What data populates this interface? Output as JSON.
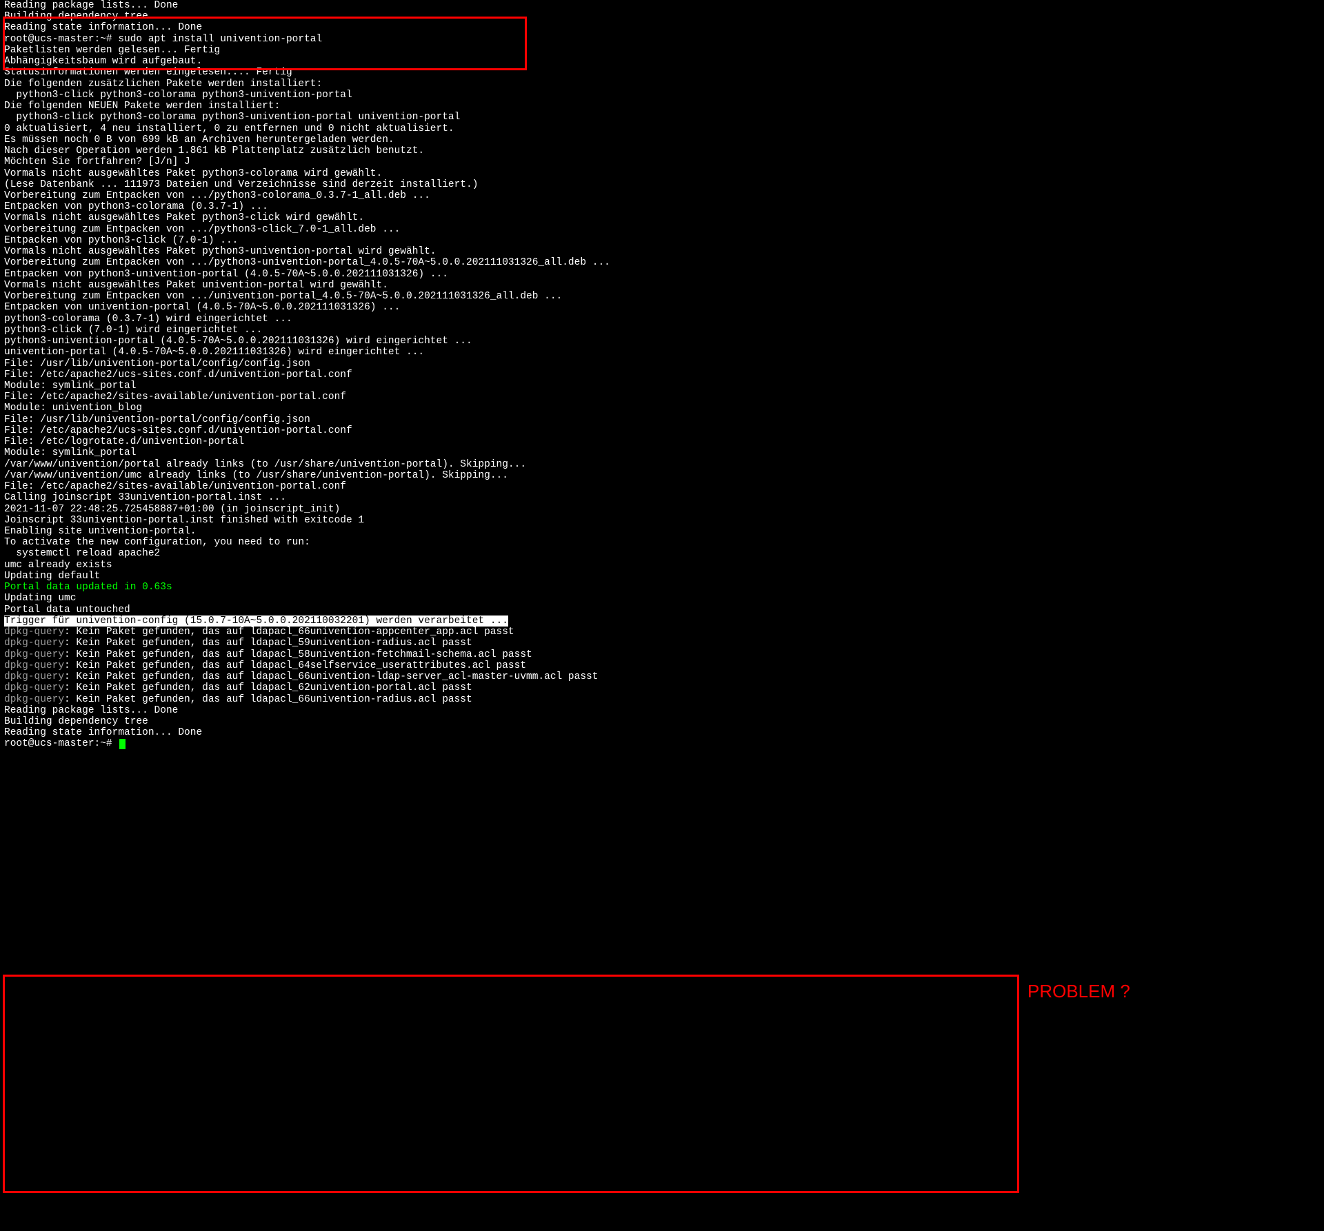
{
  "annotation": {
    "label": "PROBLEM ?"
  },
  "lines": [
    {
      "t": "Reading package lists... Done",
      "c": "white"
    },
    {
      "t": "Building dependency tree",
      "c": "white"
    },
    {
      "t": "Reading state information... Done",
      "c": "white"
    },
    {
      "t": "root@ucs-master:~# sudo apt install univention-portal",
      "c": "white",
      "kind": "prompt"
    },
    {
      "t": "Paketlisten werden gelesen... Fertig",
      "c": "white"
    },
    {
      "t": "Abhängigkeitsbaum wird aufgebaut.",
      "c": "white"
    },
    {
      "t": "Statusinformationen werden eingelesen.... Fertig",
      "c": "white"
    },
    {
      "t": "Die folgenden zusätzlichen Pakete werden installiert:",
      "c": "white"
    },
    {
      "t": "  python3-click python3-colorama python3-univention-portal",
      "c": "white"
    },
    {
      "t": "Die folgenden NEUEN Pakete werden installiert:",
      "c": "white"
    },
    {
      "t": "  python3-click python3-colorama python3-univention-portal univention-portal",
      "c": "white"
    },
    {
      "t": "0 aktualisiert, 4 neu installiert, 0 zu entfernen und 0 nicht aktualisiert.",
      "c": "white"
    },
    {
      "t": "Es müssen noch 0 B von 699 kB an Archiven heruntergeladen werden.",
      "c": "white"
    },
    {
      "t": "Nach dieser Operation werden 1.861 kB Plattenplatz zusätzlich benutzt.",
      "c": "white"
    },
    {
      "t": "Möchten Sie fortfahren? [J/n] J",
      "c": "white"
    },
    {
      "t": "Vormals nicht ausgewähltes Paket python3-colorama wird gewählt.",
      "c": "white"
    },
    {
      "t": "(Lese Datenbank ... 111973 Dateien und Verzeichnisse sind derzeit installiert.)",
      "c": "white"
    },
    {
      "t": "Vorbereitung zum Entpacken von .../python3-colorama_0.3.7-1_all.deb ...",
      "c": "white"
    },
    {
      "t": "Entpacken von python3-colorama (0.3.7-1) ...",
      "c": "white"
    },
    {
      "t": "Vormals nicht ausgewähltes Paket python3-click wird gewählt.",
      "c": "white"
    },
    {
      "t": "Vorbereitung zum Entpacken von .../python3-click_7.0-1_all.deb ...",
      "c": "white"
    },
    {
      "t": "Entpacken von python3-click (7.0-1) ...",
      "c": "white"
    },
    {
      "t": "Vormals nicht ausgewähltes Paket python3-univention-portal wird gewählt.",
      "c": "white"
    },
    {
      "t": "Vorbereitung zum Entpacken von .../python3-univention-portal_4.0.5-70A~5.0.0.202111031326_all.deb ...",
      "c": "white"
    },
    {
      "t": "Entpacken von python3-univention-portal (4.0.5-70A~5.0.0.202111031326) ...",
      "c": "white"
    },
    {
      "t": "Vormals nicht ausgewähltes Paket univention-portal wird gewählt.",
      "c": "white"
    },
    {
      "t": "Vorbereitung zum Entpacken von .../univention-portal_4.0.5-70A~5.0.0.202111031326_all.deb ...",
      "c": "white"
    },
    {
      "t": "Entpacken von univention-portal (4.0.5-70A~5.0.0.202111031326) ...",
      "c": "white"
    },
    {
      "t": "python3-colorama (0.3.7-1) wird eingerichtet ...",
      "c": "white"
    },
    {
      "t": "python3-click (7.0-1) wird eingerichtet ...",
      "c": "white"
    },
    {
      "t": "python3-univention-portal (4.0.5-70A~5.0.0.202111031326) wird eingerichtet ...",
      "c": "white"
    },
    {
      "t": "univention-portal (4.0.5-70A~5.0.0.202111031326) wird eingerichtet ...",
      "c": "white"
    },
    {
      "t": "File: /usr/lib/univention-portal/config/config.json",
      "c": "white"
    },
    {
      "t": "File: /etc/apache2/ucs-sites.conf.d/univention-portal.conf",
      "c": "white"
    },
    {
      "t": "Module: symlink_portal",
      "c": "white"
    },
    {
      "t": "File: /etc/apache2/sites-available/univention-portal.conf",
      "c": "white"
    },
    {
      "t": "Module: univention_blog",
      "c": "white"
    },
    {
      "t": "File: /usr/lib/univention-portal/config/config.json",
      "c": "white"
    },
    {
      "t": "File: /etc/apache2/ucs-sites.conf.d/univention-portal.conf",
      "c": "white"
    },
    {
      "t": "File: /etc/logrotate.d/univention-portal",
      "c": "white"
    },
    {
      "t": "Module: symlink_portal",
      "c": "white"
    },
    {
      "t": "/var/www/univention/portal already links (to /usr/share/univention-portal). Skipping...",
      "c": "white"
    },
    {
      "t": "/var/www/univention/umc already links (to /usr/share/univention-portal). Skipping...",
      "c": "white"
    },
    {
      "t": "File: /etc/apache2/sites-available/univention-portal.conf",
      "c": "white"
    },
    {
      "t": "Calling joinscript 33univention-portal.inst ...",
      "c": "white"
    },
    {
      "t": "2021-11-07 22:48:25.725458887+01:00 (in joinscript_init)",
      "c": "white"
    },
    {
      "t": "Joinscript 33univention-portal.inst finished with exitcode 1",
      "c": "white"
    },
    {
      "t": "Enabling site univention-portal.",
      "c": "white"
    },
    {
      "t": "To activate the new configuration, you need to run:",
      "c": "white"
    },
    {
      "t": "  systemctl reload apache2",
      "c": "white"
    },
    {
      "t": "umc already exists",
      "c": "white"
    },
    {
      "t": "Updating default",
      "c": "white"
    },
    {
      "t": "Portal data updated in 0.63s",
      "c": "green"
    },
    {
      "t": "Updating umc",
      "c": "white"
    },
    {
      "t": "Portal data untouched",
      "c": "white"
    },
    {
      "prefix": "Trigger für univention-config (15.0.7-10A~5.0.0.202110032201) werden verarbeitet ...",
      "kind": "inverse-tail"
    },
    {
      "label": "dpkg-query",
      "rest": ": Kein Paket gefunden, das auf ldapacl_66univention-appcenter_app.acl passt",
      "kind": "dpkg"
    },
    {
      "label": "dpkg-query",
      "rest": ": Kein Paket gefunden, das auf ldapacl_59univention-radius.acl passt",
      "kind": "dpkg"
    },
    {
      "label": "dpkg-query",
      "rest": ": Kein Paket gefunden, das auf ldapacl_58univention-fetchmail-schema.acl passt",
      "kind": "dpkg"
    },
    {
      "label": "dpkg-query",
      "rest": ": Kein Paket gefunden, das auf ldapacl_64selfservice_userattributes.acl passt",
      "kind": "dpkg"
    },
    {
      "label": "dpkg-query",
      "rest": ": Kein Paket gefunden, das auf ldapacl_66univention-ldap-server_acl-master-uvmm.acl passt",
      "kind": "dpkg"
    },
    {
      "label": "dpkg-query",
      "rest": ": Kein Paket gefunden, das auf ldapacl_62univention-portal.acl passt",
      "kind": "dpkg"
    },
    {
      "label": "dpkg-query",
      "rest": ": Kein Paket gefunden, das auf ldapacl_66univention-radius.acl passt",
      "kind": "dpkg"
    },
    {
      "t": "Reading package lists... Done",
      "c": "white"
    },
    {
      "t": "Building dependency tree",
      "c": "white"
    },
    {
      "t": "Reading state information... Done",
      "c": "white"
    },
    {
      "t": "root@ucs-master:~# ",
      "c": "white",
      "kind": "prompt-cursor"
    }
  ]
}
